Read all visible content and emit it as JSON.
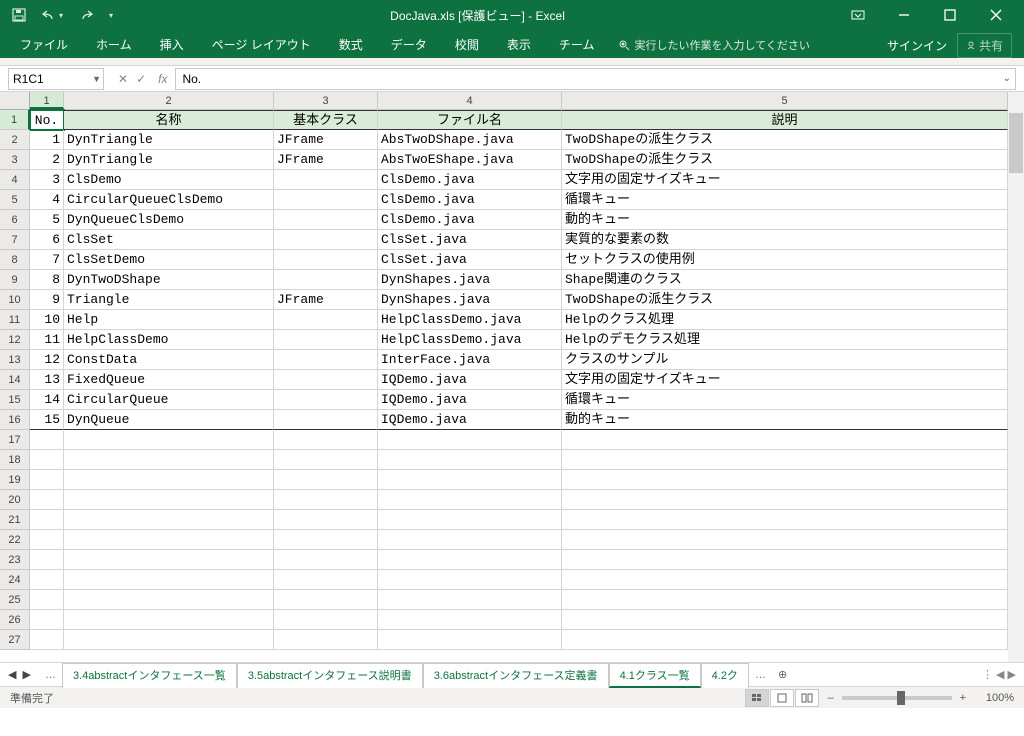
{
  "title": "DocJava.xls  [保護ビュー]  -  Excel",
  "qat": {
    "save": "save",
    "undo": "undo",
    "redo": "redo"
  },
  "tabs": [
    "ファイル",
    "ホーム",
    "挿入",
    "ページ レイアウト",
    "数式",
    "データ",
    "校閲",
    "表示",
    "チーム"
  ],
  "tellme": "実行したい作業を入力してください",
  "signin": "サインイン",
  "share": "共有",
  "namebox": "R1C1",
  "formula": "No.",
  "cols": [
    "1",
    "2",
    "3",
    "4",
    "5"
  ],
  "headers": {
    "no": "No.",
    "name": "名称",
    "base": "基本クラス",
    "file": "ファイル名",
    "desc": "説明"
  },
  "rows": [
    {
      "r": "1",
      "no": "1",
      "n": "DynTriangle",
      "b": "JFrame",
      "f": "AbsTwoDShape.java",
      "d": "TwoDShapeの派生クラス"
    },
    {
      "r": "2",
      "no": "2",
      "n": "DynTriangle",
      "b": "JFrame",
      "f": "AbsTwoEShape.java",
      "d": "TwoDShapeの派生クラス"
    },
    {
      "r": "3",
      "no": "3",
      "n": "ClsDemo",
      "b": "",
      "f": "ClsDemo.java",
      "d": "文字用の固定サイズキュー"
    },
    {
      "r": "4",
      "no": "4",
      "n": "CircularQueueClsDemo",
      "b": "",
      "f": "ClsDemo.java",
      "d": "循環キュー"
    },
    {
      "r": "5",
      "no": "5",
      "n": "DynQueueClsDemo",
      "b": "",
      "f": "ClsDemo.java",
      "d": "動的キュー"
    },
    {
      "r": "6",
      "no": "6",
      "n": "ClsSet",
      "b": "",
      "f": "ClsSet.java",
      "d": "実質的な要素の数"
    },
    {
      "r": "7",
      "no": "7",
      "n": "ClsSetDemo",
      "b": "",
      "f": "ClsSet.java",
      "d": "セットクラスの使用例"
    },
    {
      "r": "8",
      "no": "8",
      "n": "DynTwoDShape",
      "b": "",
      "f": "DynShapes.java",
      "d": "Shape関連のクラス"
    },
    {
      "r": "9",
      "no": "9",
      "n": "Triangle",
      "b": "JFrame",
      "f": "DynShapes.java",
      "d": "TwoDShapeの派生クラス"
    },
    {
      "r": "10",
      "no": "10",
      "n": "Help",
      "b": "",
      "f": "HelpClassDemo.java",
      "d": "Helpのクラス処理"
    },
    {
      "r": "11",
      "no": "11",
      "n": "HelpClassDemo",
      "b": "",
      "f": "HelpClassDemo.java",
      "d": "Helpのデモクラス処理"
    },
    {
      "r": "12",
      "no": "12",
      "n": "ConstData",
      "b": "",
      "f": "InterFace.java",
      "d": "クラスのサンプル"
    },
    {
      "r": "13",
      "no": "13",
      "n": "FixedQueue",
      "b": "",
      "f": "IQDemo.java",
      "d": "文字用の固定サイズキュー"
    },
    {
      "r": "14",
      "no": "14",
      "n": "CircularQueue",
      "b": "",
      "f": "IQDemo.java",
      "d": "循環キュー"
    },
    {
      "r": "15",
      "no": "15",
      "n": "DynQueue",
      "b": "",
      "f": "IQDemo.java",
      "d": "動的キュー"
    }
  ],
  "emptyRows": [
    "17",
    "18",
    "19",
    "20",
    "21",
    "22",
    "23",
    "24",
    "25",
    "26",
    "27"
  ],
  "sheetTabs": [
    "3.4abstractインタフェース一覧",
    "3.5abstractインタフェース説明書",
    "3.6abstractインタフェース定義書",
    "4.1クラス一覧",
    "4.2ク"
  ],
  "activeTab": 3,
  "status": "準備完了",
  "zoom": "100%"
}
